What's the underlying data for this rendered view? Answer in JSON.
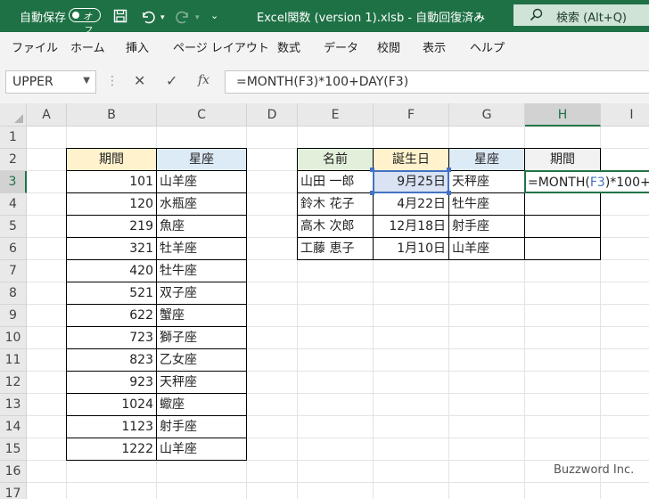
{
  "titlebar": {
    "autosave_label": "自動保存",
    "autosave_state": "オフ",
    "file_title": "Excel関数 (version 1).xlsb - 自動回復済み",
    "search_placeholder": "検索 (Alt+Q)"
  },
  "menu": [
    "ファイル",
    "ホーム",
    "挿入",
    "ページ レイアウト",
    "数式",
    "データ",
    "校閲",
    "表示",
    "ヘルプ"
  ],
  "formula_bar": {
    "name_box": "UPPER",
    "fx": "fx",
    "formula": "=MONTH(F3)*100+DAY(F3)"
  },
  "columns": [
    "A",
    "B",
    "C",
    "D",
    "E",
    "F",
    "G",
    "H",
    "I"
  ],
  "rows": [
    "1",
    "2",
    "3",
    "4",
    "5",
    "6",
    "7",
    "8",
    "9",
    "10",
    "11",
    "12",
    "13",
    "14",
    "15",
    "16",
    "17"
  ],
  "left_table": {
    "headers": [
      "期間",
      "星座"
    ],
    "rows": [
      [
        "101",
        "山羊座"
      ],
      [
        "120",
        "水瓶座"
      ],
      [
        "219",
        "魚座"
      ],
      [
        "321",
        "牡羊座"
      ],
      [
        "420",
        "牡牛座"
      ],
      [
        "521",
        "双子座"
      ],
      [
        "622",
        "蟹座"
      ],
      [
        "723",
        "獅子座"
      ],
      [
        "823",
        "乙女座"
      ],
      [
        "923",
        "天秤座"
      ],
      [
        "1024",
        "蠍座"
      ],
      [
        "1123",
        "射手座"
      ],
      [
        "1222",
        "山羊座"
      ]
    ]
  },
  "right_table": {
    "headers": [
      "名前",
      "誕生日",
      "星座",
      "期間"
    ],
    "rows": [
      [
        "山田 一郎",
        "9月25日",
        "天秤座",
        ""
      ],
      [
        "鈴木 花子",
        "4月22日",
        "牡牛座",
        ""
      ],
      [
        "高木 次郎",
        "12月18日",
        "射手座",
        ""
      ],
      [
        "工藤 恵子",
        "1月10日",
        "山羊座",
        ""
      ]
    ]
  },
  "editing_cell": {
    "pre": "=MONTH(",
    "ref": "F3",
    "post": ")*100+"
  },
  "watermark": "Buzzword Inc.",
  "colors": {
    "header_yellow": "#fff2cc",
    "header_blue": "#ddebf7",
    "header_green": "#e2efda",
    "ref_blue": "#4472c4"
  }
}
